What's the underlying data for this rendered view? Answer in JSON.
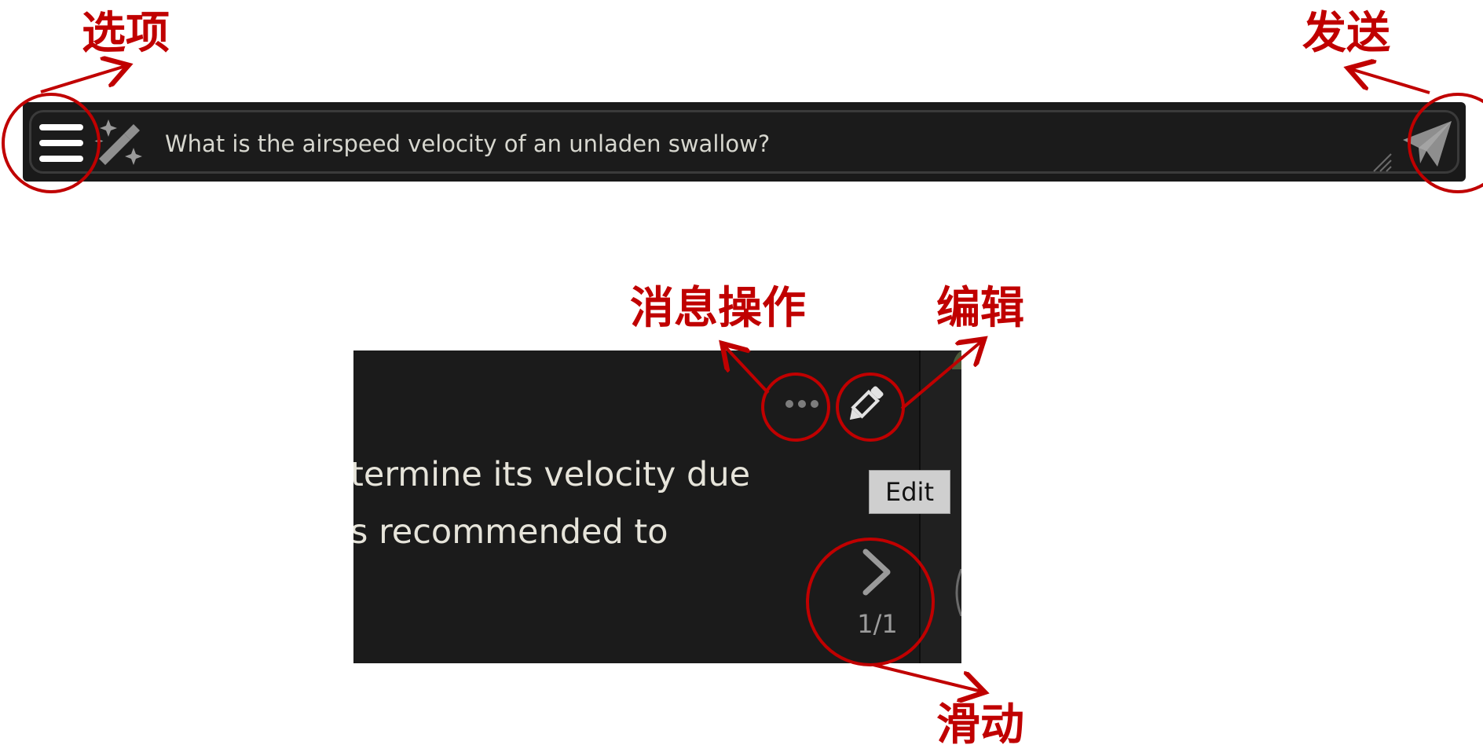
{
  "chat_bar": {
    "input_value": "What is the airspeed velocity of an unladen swallow?",
    "menu_icon": "hamburger-menu-icon",
    "wand_icon": "magic-wand-icon",
    "send_icon": "paper-plane-send-icon"
  },
  "message": {
    "lines": [
      "termine its velocity due",
      "s recommended to"
    ],
    "more_icon": "ellipsis-icon",
    "edit_icon": "pencil-icon",
    "edit_tooltip": "Edit",
    "swipe_icon": "chevron-right-icon",
    "swipe_counter": "1/1"
  },
  "annotations": {
    "options": "选项",
    "send": "发送",
    "message_actions": "消息操作",
    "edit": "编辑",
    "swipe": "滑动",
    "color": "#c00000"
  },
  "colors": {
    "panel_background": "#1b1b1b",
    "message_text": "#e6e4da",
    "input_text": "#d7d7cf",
    "icon_gray": "#9a9a9a",
    "tooltip_background": "#cfcfcf"
  }
}
